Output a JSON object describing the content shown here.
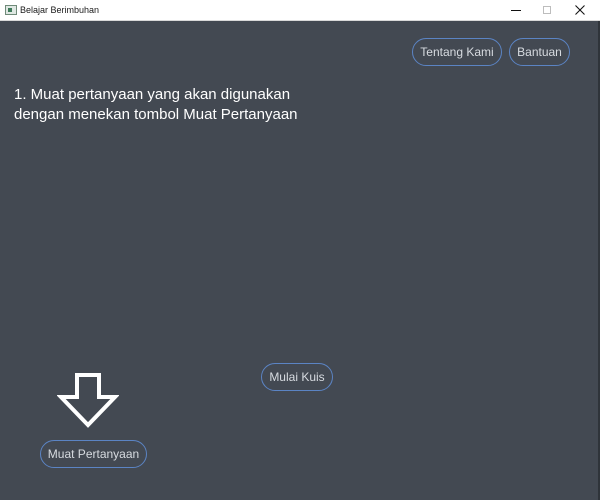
{
  "window": {
    "title": "Belajar Berimbuhan",
    "controls": {
      "minimize_icon": "minimize-icon",
      "maximize_icon": "maximize-icon",
      "close_icon": "close-icon"
    }
  },
  "header": {
    "about_label": "Tentang Kami",
    "help_label": "Bantuan"
  },
  "instruction": {
    "line1": "1. Muat pertanyaan yang akan digunakan",
    "line2": "dengan menekan tombol Muat Pertanyaan"
  },
  "actions": {
    "start_quiz_label": "Mulai Kuis",
    "load_questions_label": "Muat Pertanyaan",
    "pointer_icon": "down-arrow-icon"
  },
  "colors": {
    "background": "#434952",
    "button_border": "#5b84c4",
    "button_text": "#d7dbe0",
    "instruction_text": "#ffffff"
  }
}
